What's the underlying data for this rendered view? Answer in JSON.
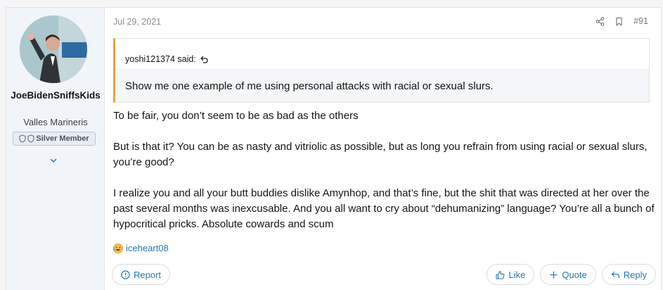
{
  "user": {
    "name": "JoeBidenSniffsKids",
    "title": "Valles Marineris",
    "rank": "Silver Member"
  },
  "post": {
    "date": "Jul 29, 2021",
    "number": "#91"
  },
  "quote": {
    "author_line": "yoshi121374 said:",
    "text": "Show me one example of me using personal attacks with racial or sexual slurs."
  },
  "message": {
    "paragraphs": [
      "To be fair, you don’t seem to be as bad as the others",
      "But is that it? You can be as nasty and vitriolic as possible, but as long you refrain from using racial or sexual slurs, you’re good?",
      "I realize you and all your butt buddies dislike Amynhop, and that’s fine, but the shit that was directed at her over the past several months was inexcusable. And you all want to cry about “dehumanizing” language? You’re all a bunch of hypocritical pricks. Absolute cowards and scum"
    ]
  },
  "reactions": {
    "emoji": "laughing-face-icon",
    "reactor": "iceheart08"
  },
  "footer": {
    "report_label": "Report",
    "like_label": "Like",
    "quote_label": "Quote",
    "reply_label": "Reply"
  },
  "colors": {
    "link": "#2577b1",
    "quote_accent": "#e6a33e",
    "sidebar_bg": "#f1f5fa"
  }
}
